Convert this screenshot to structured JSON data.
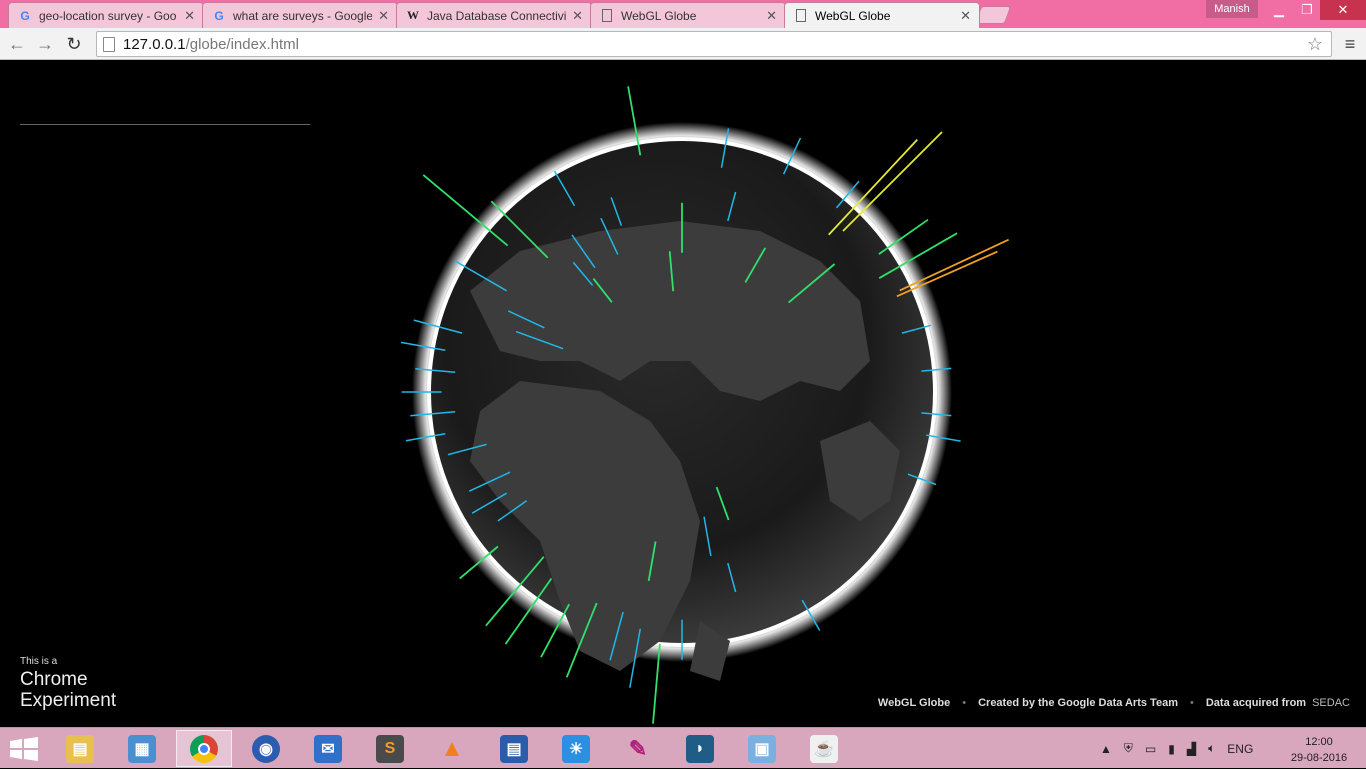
{
  "browser": {
    "tabs": [
      {
        "title": "geo-location survey - Goo",
        "icon": "google-g-icon"
      },
      {
        "title": "what are surveys - Google",
        "icon": "google-g-icon"
      },
      {
        "title": "Java Database Connectivit",
        "icon": "wikipedia-w-icon"
      },
      {
        "title": "WebGL Globe",
        "icon": "page-icon"
      },
      {
        "title": "WebGL Globe",
        "icon": "page-icon",
        "active": true
      }
    ],
    "profile_name": "Manish",
    "url_host": "127.0.0.1",
    "url_path": "/globe/index.html"
  },
  "page": {
    "chrome_experiment_small": "This is a",
    "chrome_experiment_line1": "Chrome",
    "chrome_experiment_line2": "Experiment",
    "credit_title": "WebGL Globe",
    "credit_team": "Created by the Google Data Arts Team",
    "credit_data_prefix": "Data acquired from",
    "credit_data_source": "SEDAC"
  },
  "colors": {
    "titlebar": "#f06ea3",
    "spike_low": "#1fb8e8",
    "spike_mid": "#2fe06a",
    "spike_high": "#e8e83a",
    "spike_max": "#f0a020"
  },
  "taskbar": {
    "apps": [
      {
        "name": "file-explorer-icon"
      },
      {
        "name": "control-panel-icon"
      },
      {
        "name": "chrome-icon",
        "active": true
      },
      {
        "name": "firefox-icon"
      },
      {
        "name": "mail-icon"
      },
      {
        "name": "sublime-text-icon"
      },
      {
        "name": "vlc-icon"
      },
      {
        "name": "wordpad-icon"
      },
      {
        "name": "weather-icon"
      },
      {
        "name": "feather-icon"
      },
      {
        "name": "mysql-workbench-icon"
      },
      {
        "name": "virtualbox-icon"
      },
      {
        "name": "java-icon"
      }
    ],
    "language": "ENG",
    "time": "12:00",
    "date": "29-08-2016"
  }
}
